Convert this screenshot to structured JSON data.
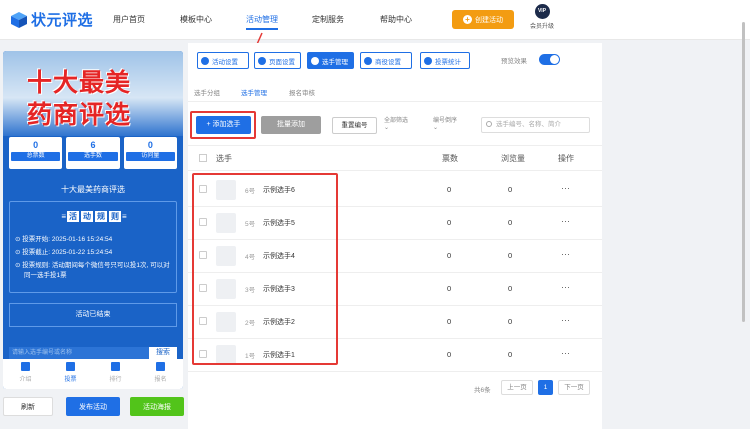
{
  "header": {
    "logo_text": "状元评选",
    "nav": [
      "用户首页",
      "模板中心",
      "活动管理",
      "定制服务",
      "帮助中心"
    ],
    "active_nav": "活动管理",
    "create_button": "创建活动",
    "vip_badge": "VIP",
    "vip_label": "会员升级"
  },
  "preview": {
    "banner_line1": "十大最美",
    "banner_line2": "药商评选",
    "stats": [
      {
        "value": "0",
        "label": "总票数"
      },
      {
        "value": "6",
        "label": "选手数"
      },
      {
        "value": "0",
        "label": "访问量"
      }
    ],
    "activity_title": "十大最美药商评选",
    "rules_heading": [
      "活",
      "动",
      "规",
      "则"
    ],
    "vote_start": "投票开始: 2025-01-16 15:24:54",
    "vote_end": "投票截止: 2025-01-22 15:24:54",
    "vote_rule": "投票规则: 活动期间每个微信号只可以投1次, 可以对同一选手投1票",
    "ended_text": "活动已结束",
    "search_placeholder": "请输入选手编号或名称",
    "search_button": "搜索",
    "tabs": [
      "介绍",
      "投票",
      "排行",
      "报名"
    ],
    "active_tab": "投票"
  },
  "bottom_buttons": {
    "refresh": "刷新",
    "publish": "发布活动",
    "poster": "活动海报"
  },
  "toolbar": {
    "buttons": [
      "活动设置",
      "页面设置",
      "选手管理",
      "商役设置",
      "投票统计"
    ],
    "active": "选手管理",
    "preview_label": "预览效果",
    "preview_on": true
  },
  "subtabs": [
    "选手分组",
    "选手管理",
    "报名审核"
  ],
  "active_subtab": "选手管理",
  "actions": {
    "add": "+ 添加选手",
    "bulk_add": "批量添加",
    "reorder": "重置编号",
    "filter_all": "全部筛选",
    "sort_order": "编号倒序",
    "search_placeholder": "选手编号、名称、简介"
  },
  "table": {
    "headers": {
      "contestant": "选手",
      "votes": "票数",
      "views": "浏览量",
      "ops": "操作"
    },
    "rows": [
      {
        "no": "6号",
        "name": "示例选手6",
        "votes": "0",
        "views": "0",
        "ops": "···"
      },
      {
        "no": "5号",
        "name": "示例选手5",
        "votes": "0",
        "views": "0",
        "ops": "···"
      },
      {
        "no": "4号",
        "name": "示例选手4",
        "votes": "0",
        "views": "0",
        "ops": "···"
      },
      {
        "no": "3号",
        "name": "示例选手3",
        "votes": "0",
        "views": "0",
        "ops": "···"
      },
      {
        "no": "2号",
        "name": "示例选手2",
        "votes": "0",
        "views": "0",
        "ops": "···"
      },
      {
        "no": "1号",
        "name": "示例选手1",
        "votes": "0",
        "views": "0",
        "ops": "···"
      }
    ]
  },
  "pagination": {
    "total": "共6条",
    "prev": "上一页",
    "current": "1",
    "next": "下一页"
  },
  "colors": {
    "primary": "#1f6fe5",
    "accent": "#f39c12",
    "highlight": "#e53935",
    "success": "#52c41a"
  }
}
